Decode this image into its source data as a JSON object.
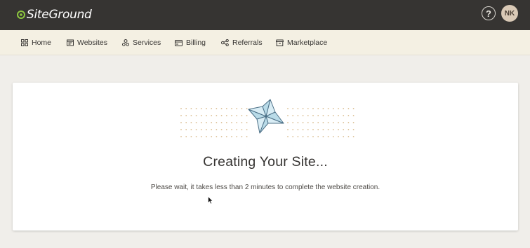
{
  "brand": {
    "name": "SiteGround"
  },
  "header": {
    "help_icon": "question-circle-icon",
    "avatar_initials": "NK"
  },
  "nav": {
    "items": [
      {
        "label": "Home",
        "icon": "grid-icon"
      },
      {
        "label": "Websites",
        "icon": "browser-window-icon"
      },
      {
        "label": "Services",
        "icon": "services-icon"
      },
      {
        "label": "Billing",
        "icon": "credit-card-icon"
      },
      {
        "label": "Referrals",
        "icon": "share-icon"
      },
      {
        "label": "Marketplace",
        "icon": "store-icon"
      }
    ]
  },
  "main": {
    "title": "Creating Your Site...",
    "subtitle": "Please wait, it takes less than 2 minutes to complete the website creation."
  },
  "colors": {
    "topbar": "#363432",
    "navbar": "#f4f0e3",
    "page_bg": "#f0eeea",
    "logo_accent": "#8dc63f",
    "dots": "#d8b98a",
    "pinwheel": "#cfe6f0"
  }
}
